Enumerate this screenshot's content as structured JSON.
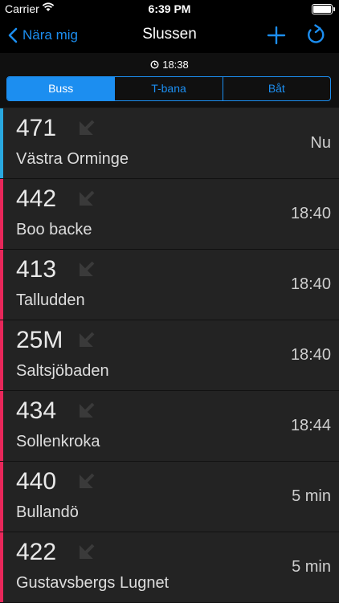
{
  "status_bar": {
    "carrier": "Carrier",
    "time": "6:39 PM",
    "battery_level": 1.0
  },
  "nav": {
    "back_label": "Nära mig",
    "title": "Slussen"
  },
  "updated_time": "18:38",
  "tabs": [
    {
      "label": "Buss",
      "active": true
    },
    {
      "label": "T-bana",
      "active": false
    },
    {
      "label": "Båt",
      "active": false
    }
  ],
  "colors": {
    "accent": "#1c8ef0",
    "line_blue": "#29a8e0",
    "line_red": "#e8275a"
  },
  "departures": [
    {
      "line": "471",
      "destination": "Västra Orminge",
      "time": "Nu",
      "color": "#29a8e0"
    },
    {
      "line": "442",
      "destination": "Boo backe",
      "time": "18:40",
      "color": "#e8275a"
    },
    {
      "line": "413",
      "destination": "Talludden",
      "time": "18:40",
      "color": "#e8275a"
    },
    {
      "line": "25M",
      "destination": "Saltsjöbaden",
      "time": "18:40",
      "color": "#e8275a"
    },
    {
      "line": "434",
      "destination": "Sollenkroka",
      "time": "18:44",
      "color": "#e8275a"
    },
    {
      "line": "440",
      "destination": "Bullandö",
      "time": "5 min",
      "color": "#e8275a"
    },
    {
      "line": "422",
      "destination": "Gustavsbergs Lugnet",
      "time": "5 min",
      "color": "#e8275a"
    }
  ]
}
